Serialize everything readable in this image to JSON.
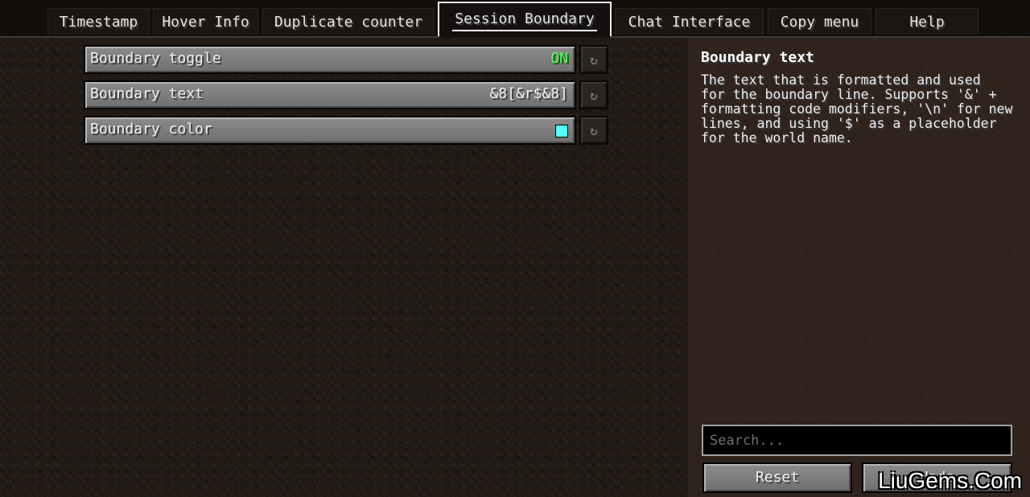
{
  "tabs": [
    {
      "label": "Timestamp"
    },
    {
      "label": "Hover Info"
    },
    {
      "label": "Duplicate counter"
    },
    {
      "label": "Session Boundary"
    },
    {
      "label": "Chat Interface"
    },
    {
      "label": "Copy menu"
    },
    {
      "label": "Help"
    }
  ],
  "options": [
    {
      "label": "Boundary toggle",
      "value": "ON"
    },
    {
      "label": "Boundary text",
      "value": "&8[&r$&8]"
    },
    {
      "label": "Boundary color",
      "swatch_color": "#55ffff"
    }
  ],
  "reset_icon": "↻",
  "description": {
    "title": "Boundary text",
    "text": "The text that is formatted and used\nfor the boundary line. Supports '&' +\nformatting code modifiers, '\\n' for new\nlines, and using '$' as a placeholder\nfor the world name."
  },
  "search": {
    "placeholder": "Search..."
  },
  "buttons": {
    "reset": "Reset",
    "second": "Undo"
  },
  "watermark": "LiuGems.Com",
  "colors": {
    "on": "#55ff55",
    "panel": "#3c2c22"
  }
}
